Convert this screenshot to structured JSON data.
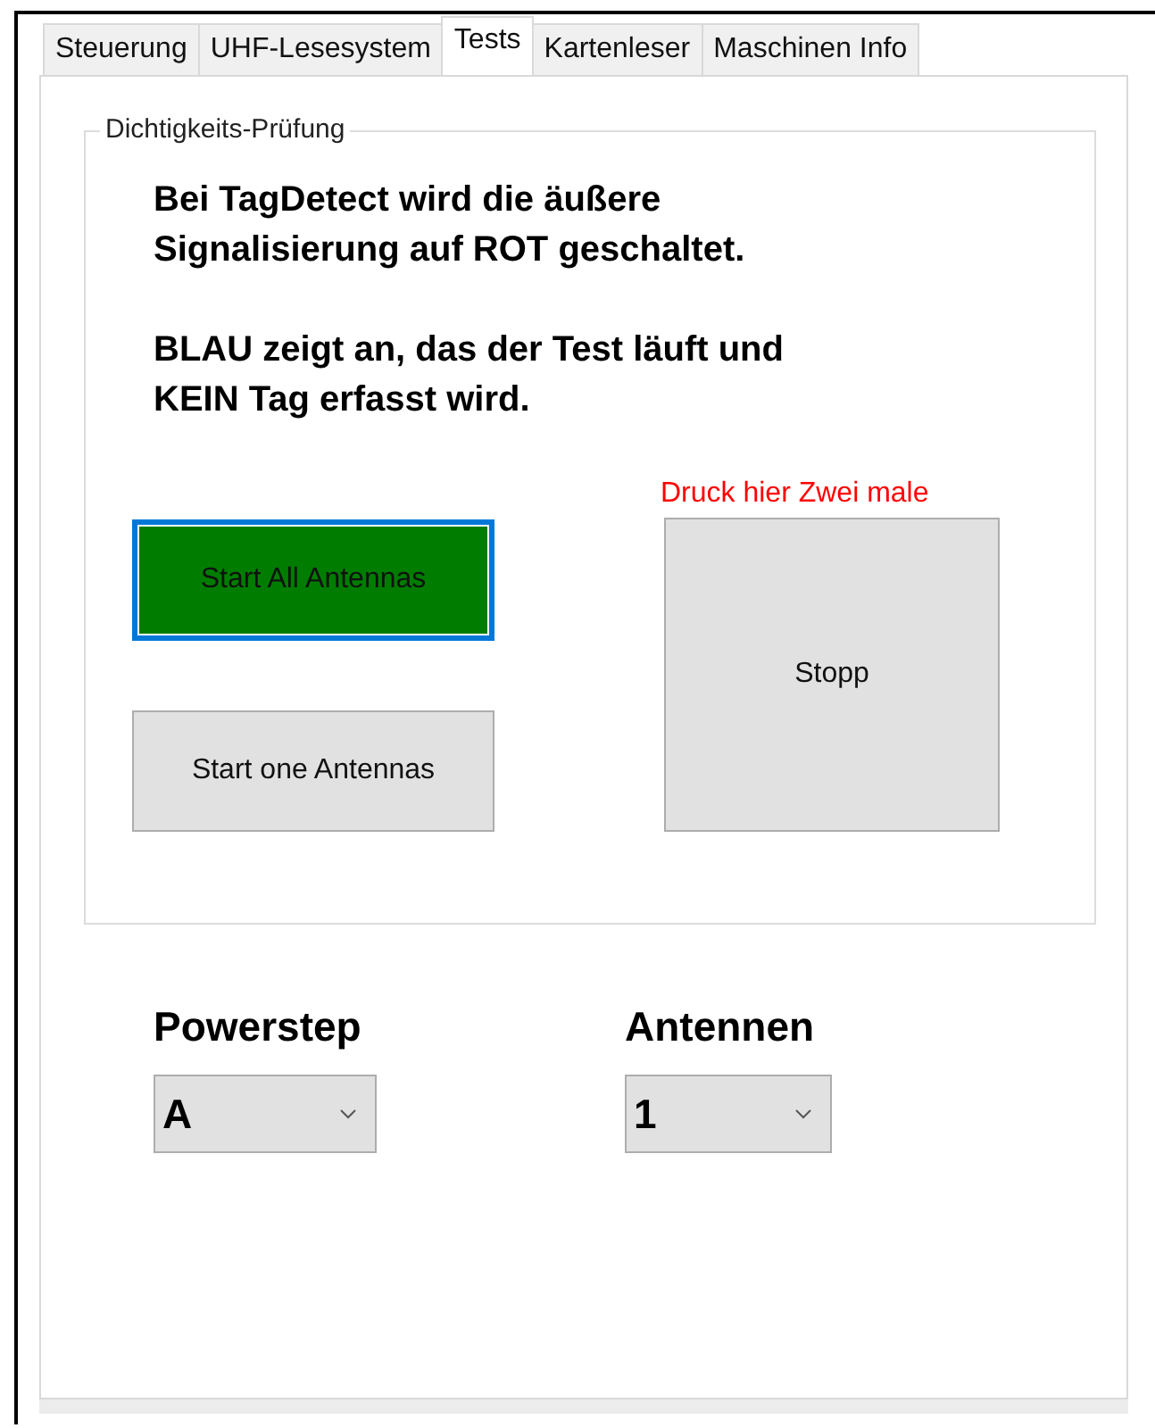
{
  "tabs": [
    {
      "label": "Steuerung",
      "selected": false
    },
    {
      "label": "UHF-Lesesystem",
      "selected": false
    },
    {
      "label": "Tests",
      "selected": true
    },
    {
      "label": "Kartenleser",
      "selected": false
    },
    {
      "label": "Maschinen Info",
      "selected": false
    }
  ],
  "group": {
    "title": "Dichtigkeits-Prüfung",
    "info": [
      "Bei TagDetect wird die äußere Signalisierung auf ROT geschaltet.",
      "BLAU zeigt an, das der Test läuft und KEIN Tag erfasst wird."
    ],
    "start_buttons": [
      {
        "label": "Start All Antennas",
        "active": true
      },
      {
        "label": "Start one Antennas",
        "active": false
      }
    ],
    "stop_hint": "Druck hier Zwei male",
    "stop_button": {
      "label": "Stopp"
    }
  },
  "selectors": [
    {
      "label": "Powerstep",
      "value": "A"
    },
    {
      "label": "Antennen",
      "value": "1"
    }
  ]
}
